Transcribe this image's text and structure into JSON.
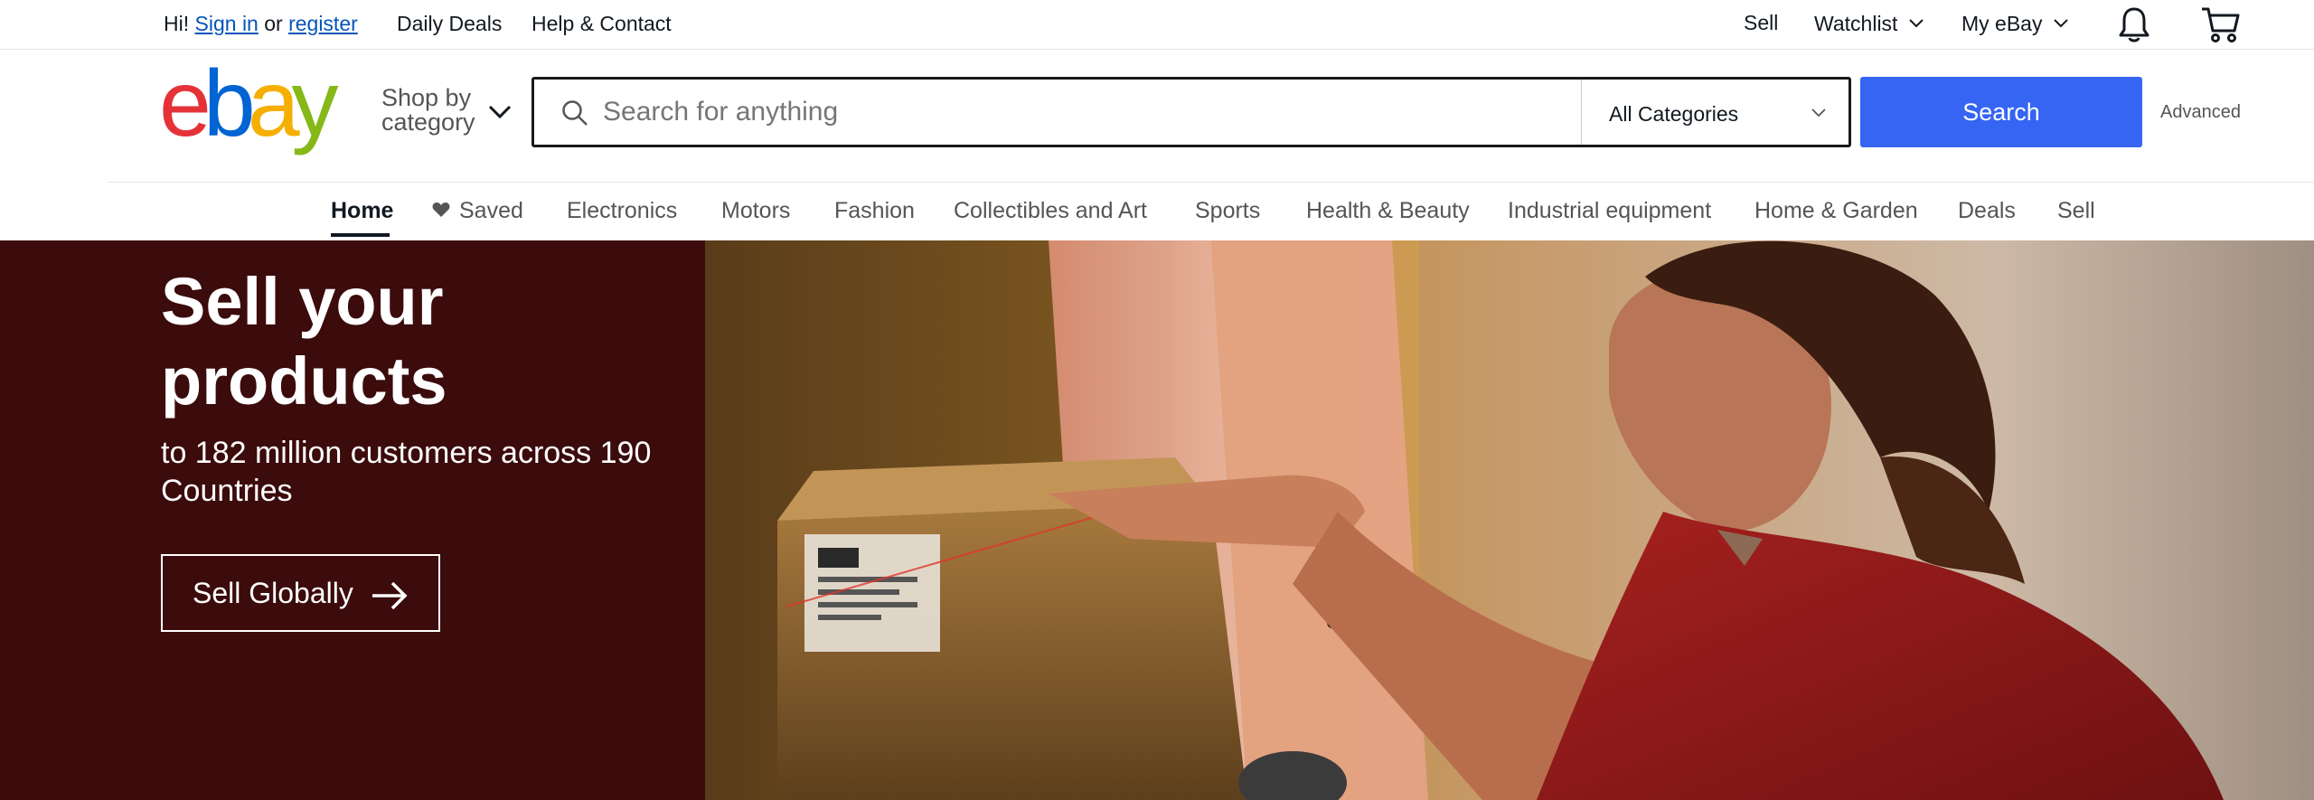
{
  "topbar": {
    "greeting_prefix": "Hi!",
    "sign_in": "Sign in",
    "or": "or",
    "register": "register",
    "daily_deals": "Daily Deals",
    "help_contact": "Help & Contact",
    "sell": "Sell",
    "watchlist": "Watchlist",
    "my_ebay": "My eBay",
    "icons": [
      "chevron-down-icon",
      "bell-icon",
      "cart-icon"
    ]
  },
  "header": {
    "logo_letters": [
      "e",
      "b",
      "a",
      "y"
    ],
    "logo_colors": [
      "#e53238",
      "#0064d2",
      "#f5af02",
      "#86b817"
    ],
    "shop_by_line1": "Shop by",
    "shop_by_line2": "category",
    "search_placeholder": "Search for anything",
    "category_selected": "All Categories",
    "search_button": "Search",
    "advanced": "Advanced",
    "accent_color": "#3665f3"
  },
  "nav": {
    "items": [
      {
        "label": "Home",
        "active": true
      },
      {
        "label": "Saved",
        "icon": "heart-icon"
      },
      {
        "label": "Electronics"
      },
      {
        "label": "Motors"
      },
      {
        "label": "Fashion"
      },
      {
        "label": "Collectibles and Art"
      },
      {
        "label": "Sports"
      },
      {
        "label": "Health & Beauty"
      },
      {
        "label": "Industrial equipment"
      },
      {
        "label": "Home & Garden"
      },
      {
        "label": "Deals"
      },
      {
        "label": "Sell"
      }
    ]
  },
  "hero": {
    "title": "Sell your products",
    "subtitle": "to 182 million customers across 190 Countries",
    "cta": "Sell Globally",
    "background_color": "#3c0b0c"
  }
}
